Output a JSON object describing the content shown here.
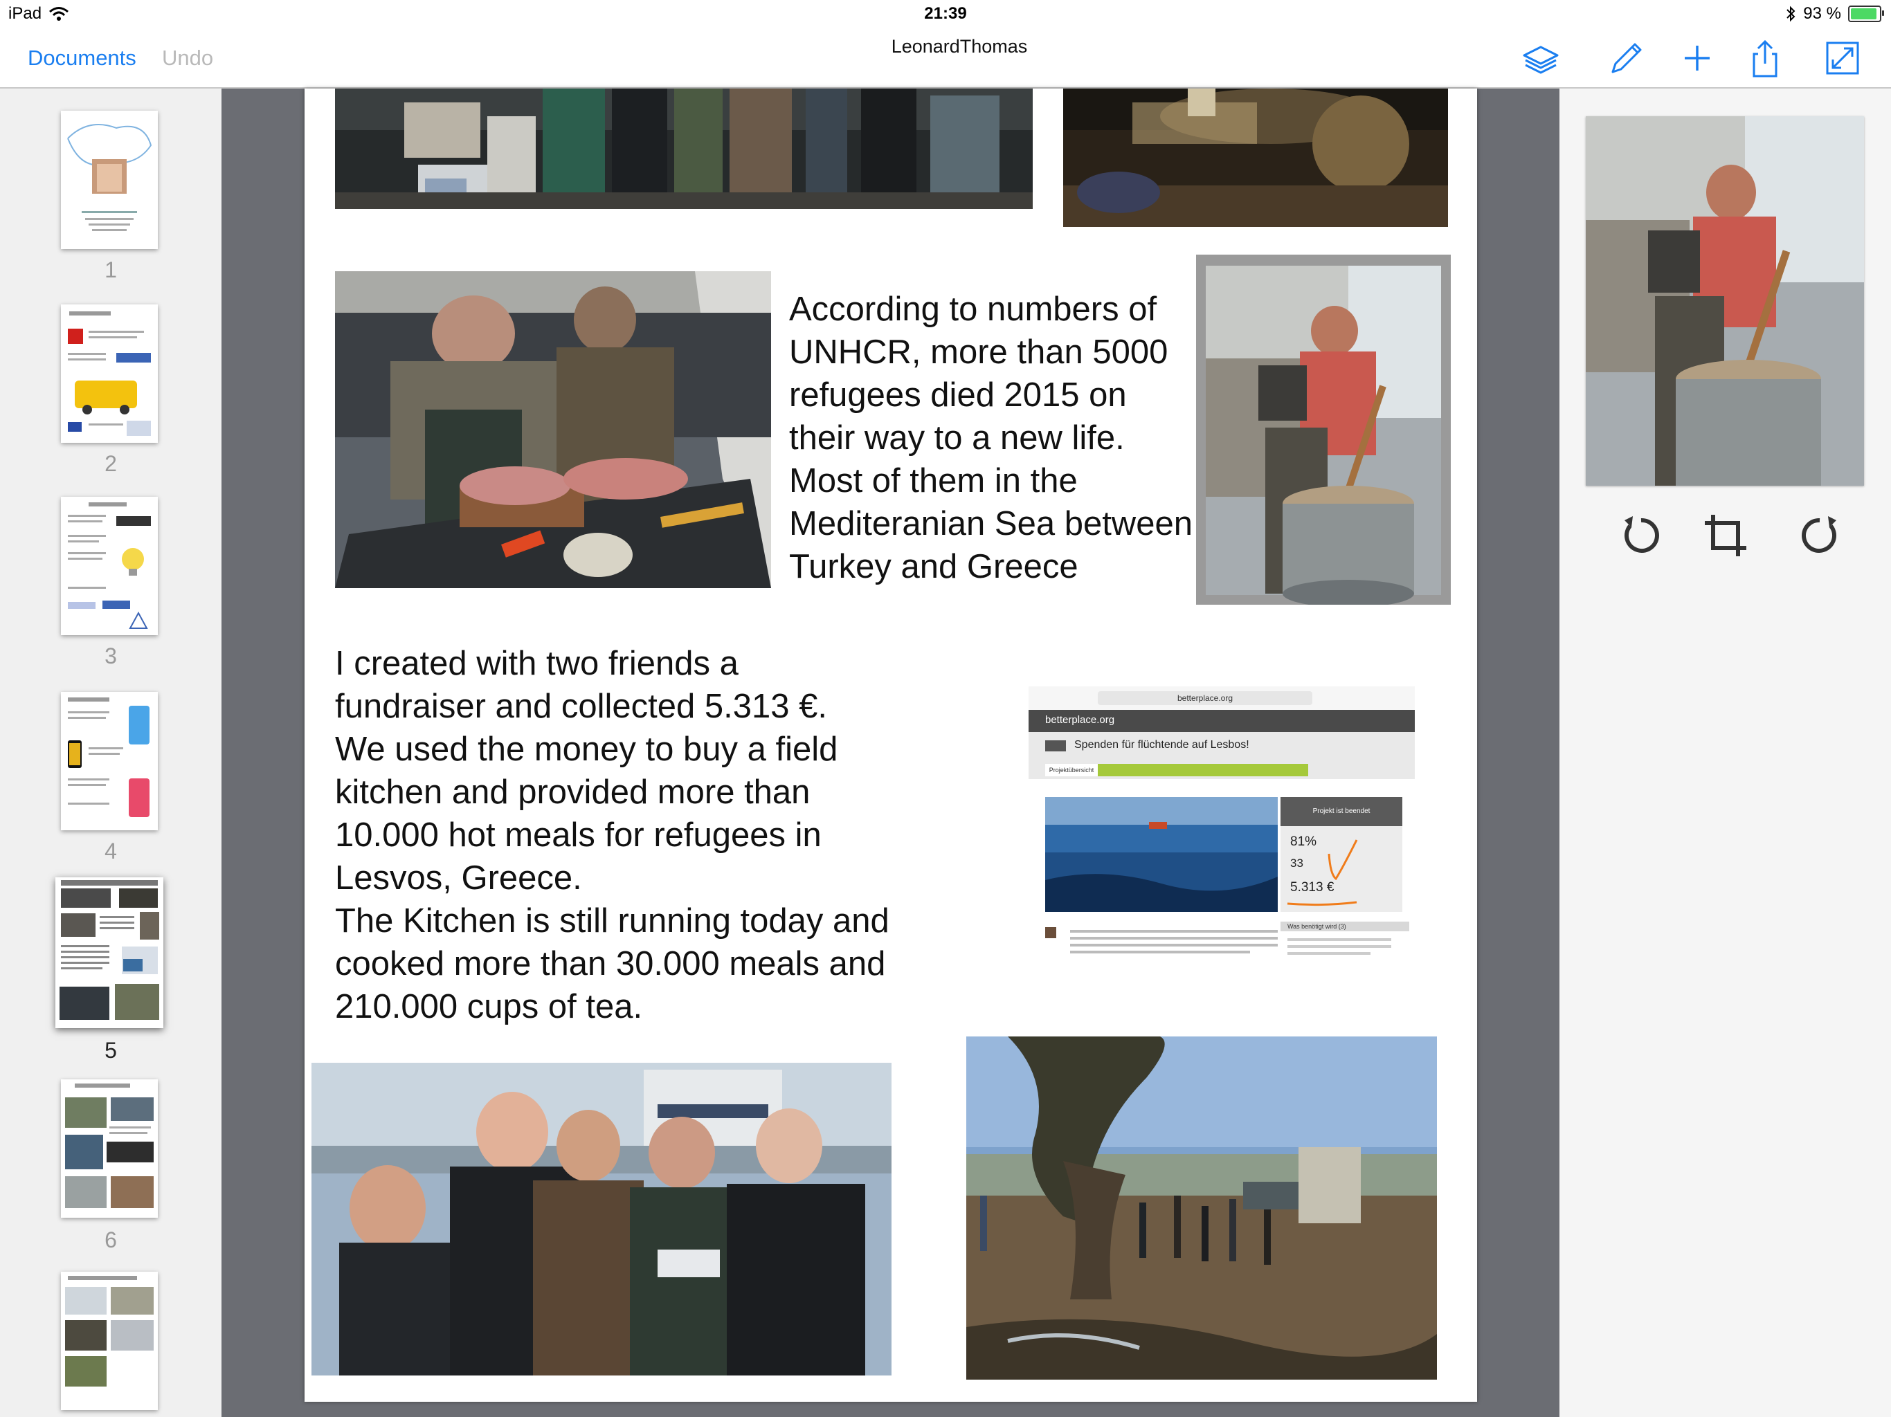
{
  "status_bar": {
    "device": "iPad",
    "time": "21:39",
    "battery_text": "93 %",
    "battery_level": 0.93
  },
  "nav": {
    "documents_label": "Documents",
    "undo_label": "Undo",
    "title": "LeonardThomas",
    "icons": [
      "layers-icon",
      "pencil-icon",
      "plus-icon",
      "share-icon",
      "fullscreen-icon"
    ]
  },
  "thumbnails": [
    {
      "number": "1",
      "selected": false
    },
    {
      "number": "2",
      "selected": false
    },
    {
      "number": "3",
      "selected": false
    },
    {
      "number": "4",
      "selected": false
    },
    {
      "number": "5",
      "selected": true
    },
    {
      "number": "6",
      "selected": false
    }
  ],
  "page": {
    "paragraph1": "According to numbers of\nUNHCR, more than 5000\nrefugees died 2015 on\ntheir way to a new life.\nMost of them in the\nMediteranian Sea between\nTurkey and Greece",
    "paragraph2": "I created with two friends a\nfundraiser and collected 5.313 €.\nWe used the money to buy a field\nkitchen and provided more than\n10.000 hot meals for refugees in\nLesvos, Greece.\nThe Kitchen is still running today and\ncooked more than 30.000 meals and\n210.000 cups of tea.",
    "screenshot": {
      "url": "betterplace.org",
      "logo": "betterplace.org",
      "heading": "Spenden für flüchtende auf Lesbos!",
      "tab_active": "Projektübersicht",
      "status": "Projekt ist beendet",
      "percent": "81%",
      "donors": "33",
      "amount": "5.313 €",
      "side_title": "Was benötigt wird (3)"
    }
  },
  "inspector": {
    "tools": [
      "rotate-left-icon",
      "crop-icon",
      "rotate-right-icon"
    ]
  },
  "colors": {
    "accent": "#1a7ef0",
    "canvas": "#6b6d73",
    "betterplace_green": "#a5c93a"
  }
}
